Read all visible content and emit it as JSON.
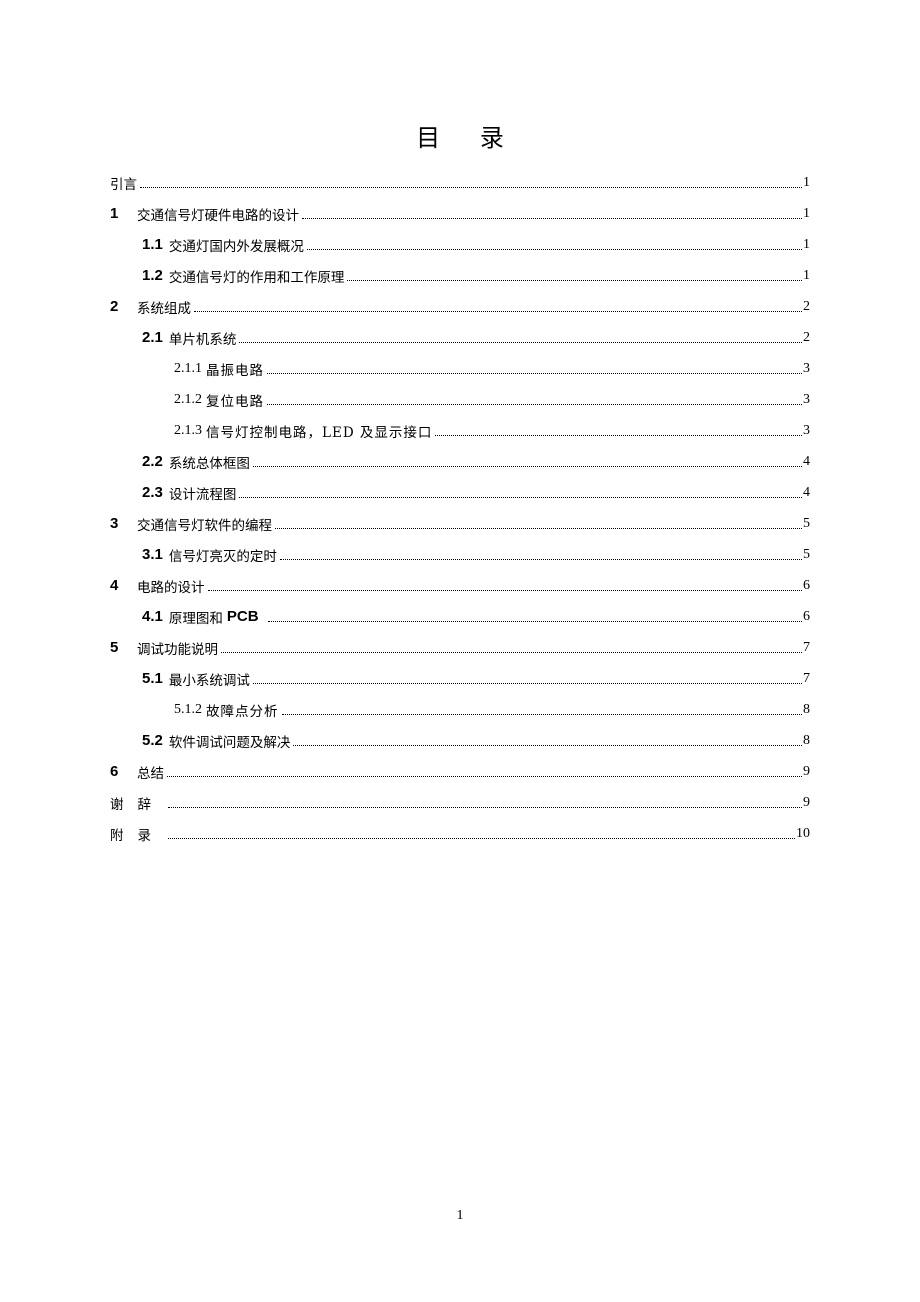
{
  "title": {
    "char1": "目",
    "char2": "录"
  },
  "toc": [
    {
      "level": 0,
      "num": "",
      "text": "引言",
      "page": "1"
    },
    {
      "level": 1,
      "num": "1",
      "text": "交通信号灯硬件电路的设计",
      "page": "1"
    },
    {
      "level": 2,
      "num": "1.1",
      "text": "交通灯国内外发展概况",
      "page": "1"
    },
    {
      "level": 2,
      "num": "1.2",
      "text": "交通信号灯的作用和工作原理",
      "page": "1"
    },
    {
      "level": 1,
      "num": "2",
      "text": "系统组成",
      "page": "2"
    },
    {
      "level": 2,
      "num": "2.1",
      "text": "单片机系统",
      "page": "2"
    },
    {
      "level": 3,
      "num": "2.1.1",
      "text": "晶振电路",
      "page": "3"
    },
    {
      "level": 3,
      "num": "2.1.2",
      "text": "复位电路",
      "page": "3"
    },
    {
      "level": 3,
      "num": "2.1.3",
      "text": "信号灯控制电路，LED 及显示接口",
      "page": "3"
    },
    {
      "level": 2,
      "num": "2.2",
      "text": "系统总体框图",
      "page": "4"
    },
    {
      "level": 2,
      "num": "2.3",
      "text": "设计流程图",
      "page": "4"
    },
    {
      "level": 1,
      "num": "3",
      "text": "交通信号灯软件的编程",
      "page": "5"
    },
    {
      "level": 2,
      "num": "3.1",
      "text": "信号灯亮灭的定时",
      "page": "5"
    },
    {
      "level": 1,
      "num": "4",
      "text": "电路的设计",
      "page": "6"
    },
    {
      "level": 2,
      "num": "4.1",
      "text": "原理图和",
      "text_bold_suffix": "PCB",
      "page": "6"
    },
    {
      "level": 1,
      "num": "5",
      "text": "调试功能说明",
      "page": "7"
    },
    {
      "level": 2,
      "num": "5.1",
      "text": "最小系统调试",
      "page": "7"
    },
    {
      "level": 3,
      "num": "5.1.2",
      "text": "故障点分析",
      "page": "8"
    },
    {
      "level": 2,
      "num": "5.2",
      "text": "软件调试问题及解决",
      "page": "8"
    },
    {
      "level": 1,
      "num": "6",
      "text": "总结",
      "page": "9"
    },
    {
      "level": 0,
      "num": "",
      "text": "谢辞",
      "spaced": true,
      "page": "9"
    },
    {
      "level": 0,
      "num": "",
      "text": "附录",
      "spaced": true,
      "page": "10"
    }
  ],
  "footer": {
    "page_number": "1"
  }
}
